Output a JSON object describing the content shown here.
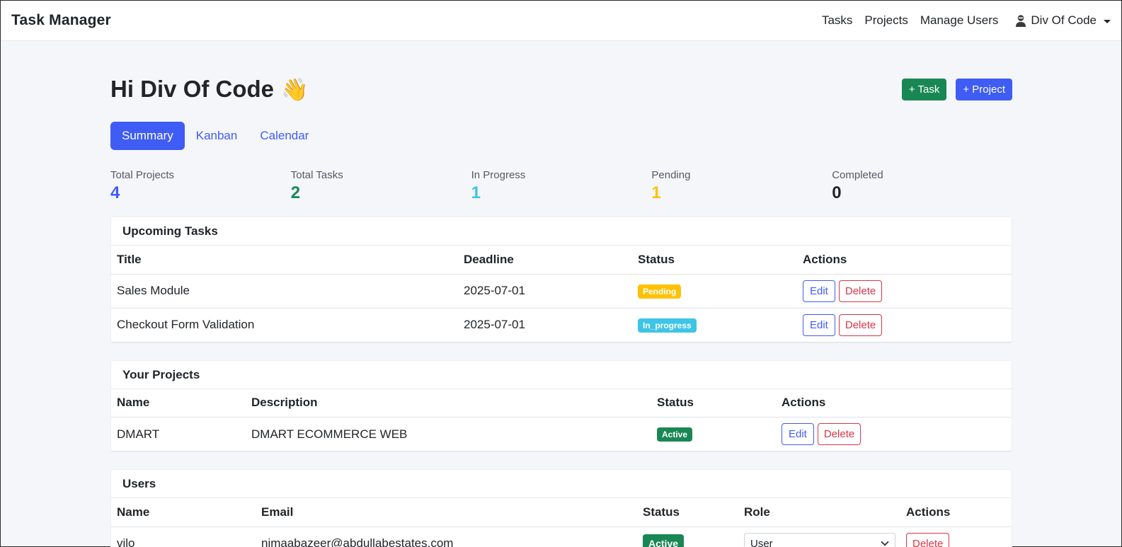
{
  "navbar": {
    "brand": "Task Manager",
    "links": [
      "Tasks",
      "Projects",
      "Manage Users"
    ],
    "user": "Div Of Code"
  },
  "header": {
    "greeting": "Hi Div Of Code",
    "wave": "👋",
    "add_task": "+ Task",
    "add_project": "+ Project"
  },
  "tabs": [
    "Summary",
    "Kanban",
    "Calendar"
  ],
  "stats": [
    {
      "label": "Total Projects",
      "value": "4",
      "color": "#3f5cf5"
    },
    {
      "label": "Total Tasks",
      "value": "2",
      "color": "#198754"
    },
    {
      "label": "In Progress",
      "value": "1",
      "color": "#3dc4e6"
    },
    {
      "label": "Pending",
      "value": "1",
      "color": "#ffc107"
    },
    {
      "label": "Completed",
      "value": "0",
      "color": "#212529"
    }
  ],
  "upcoming": {
    "title": "Upcoming Tasks",
    "columns": [
      "Title",
      "Deadline",
      "Status",
      "Actions"
    ],
    "rows": [
      {
        "title": "Sales Module",
        "deadline": "2025-07-01",
        "status": "Pending"
      },
      {
        "title": "Checkout Form Validation",
        "deadline": "2025-07-01",
        "status": "In_progress"
      }
    ]
  },
  "projects": {
    "title": "Your Projects",
    "columns": [
      "Name",
      "Description",
      "Status",
      "Actions"
    ],
    "rows": [
      {
        "name": "DMART",
        "description": "DMART ECOMMERCE WEB",
        "status": "Active"
      }
    ]
  },
  "users": {
    "title": "Users",
    "columns": [
      "Name",
      "Email",
      "Status",
      "Role",
      "Actions"
    ],
    "rows": [
      {
        "name": "vilo",
        "email": "nimaabazeer@abdullabestates.com",
        "status": "Active",
        "role": "User"
      }
    ]
  },
  "actions": {
    "edit": "Edit",
    "delete": "Delete"
  },
  "colors": {
    "primary": "#3f5cf5",
    "success": "#198754",
    "warning": "#ffc107",
    "info": "#3dc4e6",
    "danger": "#dc3545"
  }
}
